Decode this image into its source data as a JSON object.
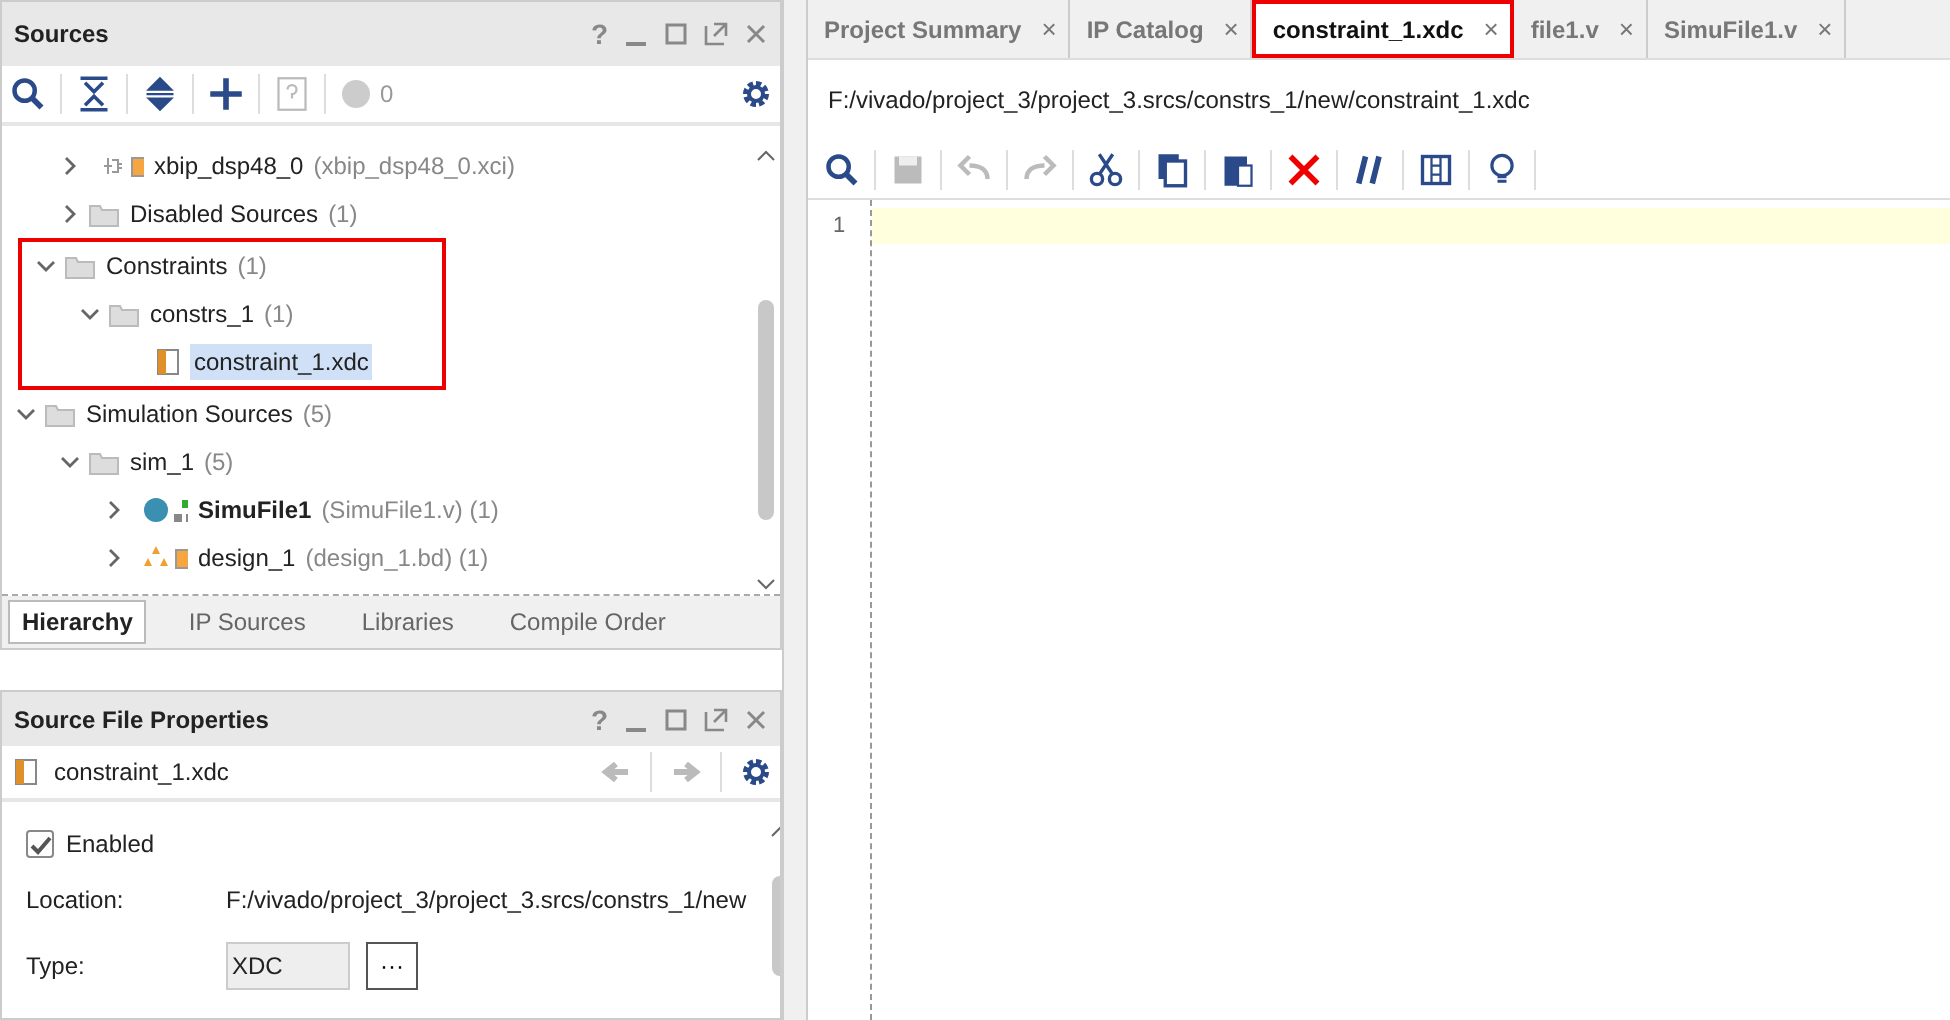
{
  "sources_panel": {
    "title": "Sources",
    "window_buttons": [
      "?"
    ],
    "toolbar": {
      "count": "0"
    },
    "tree": [
      {
        "children": [
          {
            "label": "xbip_dsp48_0",
            "note": "(xbip_dsp48_0.xci)",
            "kind": "ip",
            "expanded": false
          },
          {
            "label": "Disabled Sources",
            "note": "(1)",
            "kind": "folder",
            "expanded": false
          }
        ]
      },
      {
        "label": "Constraints",
        "note": "(1)",
        "kind": "folder",
        "expanded": true,
        "highlighted": true,
        "children": [
          {
            "label": "constrs_1",
            "note": "(1)",
            "kind": "folder",
            "expanded": true,
            "children": [
              {
                "label": "constraint_1.xdc",
                "kind": "xdc",
                "selected": true
              }
            ]
          }
        ]
      },
      {
        "label": "Simulation Sources",
        "note": "(5)",
        "kind": "folder",
        "expanded": true,
        "children": [
          {
            "label": "sim_1",
            "note": "(5)",
            "kind": "folder",
            "expanded": true,
            "children": [
              {
                "label": "SimuFile1",
                "note": "(SimuFile1.v) (1)",
                "kind": "sim",
                "bold": true,
                "expanded": false
              },
              {
                "label": "design_1",
                "note": "(design_1.bd) (1)",
                "kind": "bd",
                "expanded": false
              }
            ]
          }
        ]
      }
    ],
    "tabs": [
      {
        "label": "Hierarchy",
        "selected": true
      },
      {
        "label": "IP Sources",
        "selected": false
      },
      {
        "label": "Libraries",
        "selected": false
      },
      {
        "label": "Compile Order",
        "selected": false
      }
    ]
  },
  "properties_panel": {
    "title": "Source File Properties",
    "window_buttons": [
      "?"
    ],
    "file": "constraint_1.xdc",
    "enabled": {
      "label": "Enabled",
      "checked": true
    },
    "location": {
      "label": "Location:",
      "value": "F:/vivado/project_3/project_3.srcs/constrs_1/new"
    },
    "type": {
      "label": "Type:",
      "value": "XDC",
      "button": "···"
    }
  },
  "editor": {
    "tabs": [
      {
        "label": "Project Summary",
        "close": "×",
        "selected": false
      },
      {
        "label": "IP Catalog",
        "close": "×",
        "selected": false
      },
      {
        "label": "constraint_1.xdc",
        "close": "×",
        "selected": true,
        "highlighted": true
      },
      {
        "label": "file1.v",
        "close": "×",
        "selected": false
      },
      {
        "label": "SimuFile1.v",
        "close": "×",
        "selected": false
      }
    ],
    "path": "F:/vivado/project_3/project_3.srcs/constrs_1/new/constraint_1.xdc",
    "lines": [
      {
        "number": "1",
        "current": true
      }
    ]
  }
}
